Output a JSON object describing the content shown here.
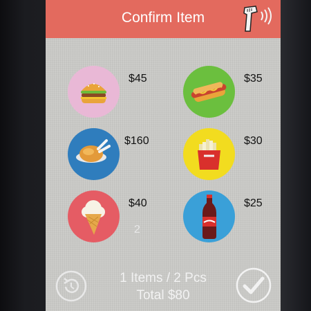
{
  "header": {
    "title": "Confirm Item",
    "scanner_icon": "barcode-scanner-icon"
  },
  "items": [
    {
      "name": "burger",
      "icon": "burger-icon",
      "price": "$45",
      "qty": "",
      "bg": "#e9b8d6"
    },
    {
      "name": "hotdog",
      "icon": "hotdog-icon",
      "price": "$35",
      "qty": "",
      "bg": "#6bbf3e"
    },
    {
      "name": "chicken",
      "icon": "chicken-icon",
      "price": "$160",
      "qty": "",
      "bg": "#2f7dbd"
    },
    {
      "name": "fries",
      "icon": "fries-icon",
      "price": "$30",
      "qty": "",
      "bg": "#f2dc1f"
    },
    {
      "name": "icecream",
      "icon": "ice-cream-icon",
      "price": "$40",
      "qty": "2",
      "bg": "#e55c64"
    },
    {
      "name": "cola",
      "icon": "cola-bottle-icon",
      "price": "$25",
      "qty": "",
      "bg": "#3aa0d8"
    }
  ],
  "footer": {
    "summary_line": "1 Items / 2 Pcs",
    "total_line": "Total $80",
    "reset_icon": "reset-icon",
    "confirm_icon": "checkmark-icon"
  },
  "colors": {
    "header": "#e36a5e",
    "screen_bg": "#c9c9c6"
  }
}
